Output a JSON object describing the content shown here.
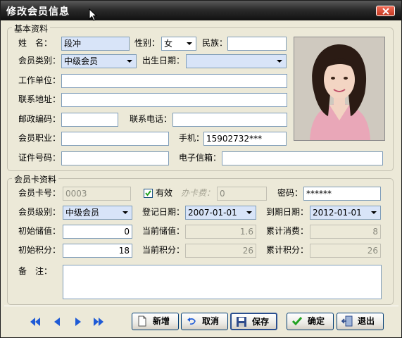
{
  "window": {
    "title": "修改会员信息"
  },
  "basic": {
    "group_title": "基本资料",
    "name_label": "姓　名：",
    "name_value": "段冲",
    "gender_label": "性别：",
    "gender_value": "女",
    "ethnicity_label": "民族：",
    "ethnicity_value": "",
    "member_type_label": "会员类别：",
    "member_type_value": "中级会员",
    "birth_label": "出生日期：",
    "birth_value": "",
    "workplace_label": "工作单位：",
    "workplace_value": "",
    "address_label": "联系地址：",
    "address_value": "",
    "postcode_label": "邮政编码：",
    "postcode_value": "",
    "phone_label": "联系电话：",
    "phone_value": "",
    "occupation_label": "会员职业：",
    "occupation_value": "",
    "mobile_label": "手机：",
    "mobile_value": "15902732***",
    "id_label": "证件号码：",
    "id_value": "",
    "email_label": "电子信箱：",
    "email_value": ""
  },
  "card": {
    "group_title": "会员卡资料",
    "card_no_label": "会员卡号：",
    "card_no_value": "0003",
    "valid_label": "有效",
    "valid_checked": true,
    "fee_label": "办卡费：",
    "fee_value": "0",
    "password_label": "密码：",
    "password_value": "******",
    "level_label": "会员级别：",
    "level_value": "中级会员",
    "reg_date_label": "登记日期：",
    "reg_date_value": "2007-01-01",
    "expire_label": "到期日期：",
    "expire_value": "2012-01-01",
    "init_balance_label": "初始储值：",
    "init_balance_value": "0",
    "cur_balance_label": "当前储值：",
    "cur_balance_value": "1.6",
    "total_spend_label": "累计消费：",
    "total_spend_value": "8",
    "init_points_label": "初始积分：",
    "init_points_value": "18",
    "cur_points_label": "当前积分：",
    "cur_points_value": "26",
    "total_points_label": "累计积分：",
    "total_points_value": "26",
    "remark_label": "备　注：",
    "remark_value": ""
  },
  "buttons": {
    "add": "新增",
    "cancel": "取消",
    "save": "保存",
    "ok": "确定",
    "exit": "退出"
  },
  "icons": [
    "first-record-icon",
    "prev-record-icon",
    "next-record-icon",
    "last-record-icon",
    "new-doc-icon",
    "undo-icon",
    "save-disk-icon",
    "checkmark-icon",
    "exit-door-icon",
    "close-icon"
  ],
  "colors": {
    "window_bg": "#ECE9D8",
    "title_bg": "#2b2b2b",
    "accent_blue": "#1F5BD6",
    "highlight_input": "#D8E4F8"
  }
}
